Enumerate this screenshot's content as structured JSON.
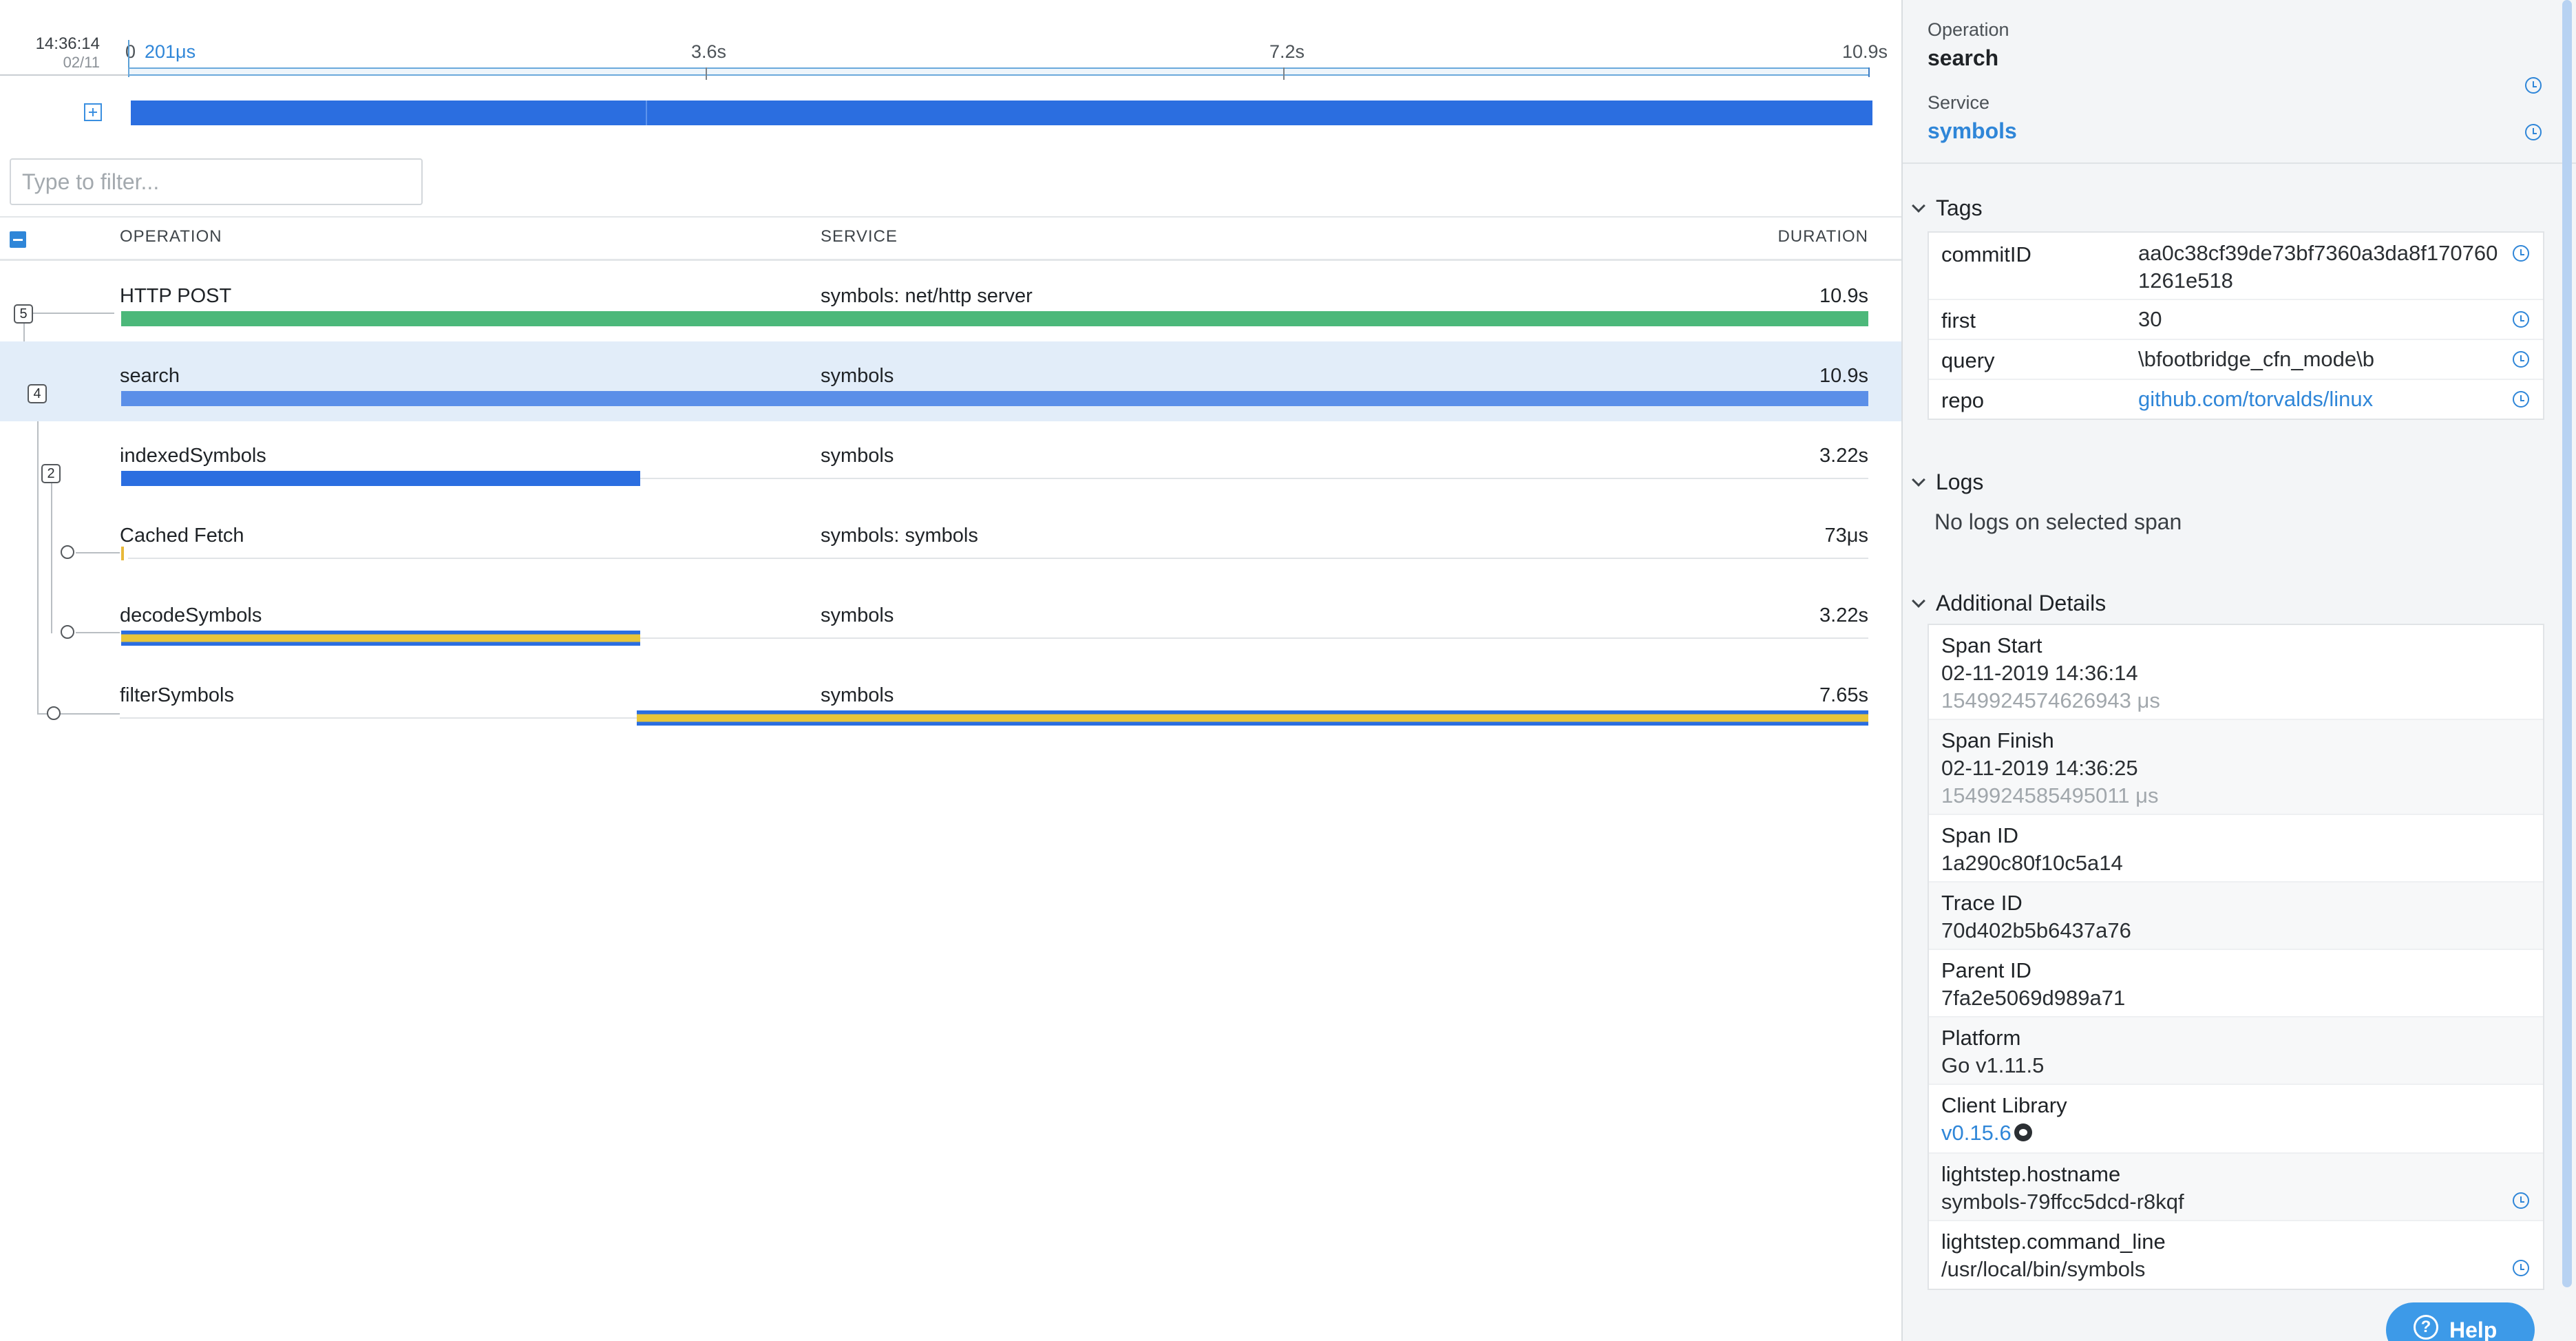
{
  "timeline": {
    "start_time": "14:36:14",
    "start_date": "02/11",
    "trunc_label": "0",
    "start_label": "201μs",
    "ticks": [
      "3.6s",
      "7.2s",
      "10.9s"
    ]
  },
  "filter": {
    "placeholder": "Type to filter...",
    "value": ""
  },
  "table": {
    "headers": {
      "operation": "OPERATION",
      "service": "SERVICE",
      "duration": "DURATION"
    },
    "rows": [
      {
        "operation": "HTTP POST",
        "service": "symbols: net/http server",
        "duration": "10.9s",
        "badge": "5",
        "bar_color": "#4cb87a",
        "bar_start": 0.0,
        "bar_end": 1.0,
        "selected": false
      },
      {
        "operation": "search",
        "service": "symbols",
        "duration": "10.9s",
        "badge": "4",
        "bar_color": "#5b8fe8",
        "bar_start": 0.0,
        "bar_end": 1.0,
        "selected": true
      },
      {
        "operation": "indexedSymbols",
        "service": "symbols",
        "duration": "3.22s",
        "badge": "2",
        "bar_color": "#2b6ee0",
        "bar_start": 0.0,
        "bar_end": 0.297,
        "selected": false
      },
      {
        "operation": "Cached Fetch",
        "service": "symbols: symbols",
        "duration": "73μs",
        "badge": "",
        "bar_color": "#e8b93a",
        "bar_start": 0.0,
        "bar_end": 0.001,
        "selected": false
      },
      {
        "operation": "decodeSymbols",
        "service": "symbols",
        "duration": "3.22s",
        "badge": "",
        "bar_color": "#e8c53a",
        "bar_start": 0.0,
        "bar_end": 0.297,
        "selected": false
      },
      {
        "operation": "filterSymbols",
        "service": "symbols",
        "duration": "7.65s",
        "badge": "",
        "bar_color": "#e8c53a",
        "bar_start": 0.295,
        "bar_end": 1.0,
        "selected": false
      }
    ]
  },
  "details": {
    "operation_label": "Operation",
    "operation_value": "search",
    "service_label": "Service",
    "service_value": "symbols",
    "tags_title": "Tags",
    "tags": [
      {
        "key": "commitID",
        "value": "aa0c38cf39de73bf7360a3da8f1707601261e518"
      },
      {
        "key": "first",
        "value": "30"
      },
      {
        "key": "query",
        "value": "\\bfootbridge_cfn_mode\\b"
      },
      {
        "key": "repo",
        "value": "github.com/torvalds/linux"
      }
    ],
    "commit_line1": "aa0c38cf39de73bf7360a3da8f170760",
    "commit_line2": "1261e518",
    "logs_title": "Logs",
    "logs_empty": "No logs on selected span",
    "additional_title": "Additional Details",
    "span_start_label": "Span Start",
    "span_start_value": "02-11-2019 14:36:14",
    "span_start_micros": "1549924574626943 μs",
    "span_finish_label": "Span Finish",
    "span_finish_value": "02-11-2019 14:36:25",
    "span_finish_micros": "1549924585495011 μs",
    "span_id_label": "Span ID",
    "span_id_value": "1a290c80f10c5a14",
    "trace_id_label": "Trace ID",
    "trace_id_value": "70d402b5b6437a76",
    "parent_id_label": "Parent ID",
    "parent_id_value": "7fa2e5069d989a71",
    "platform_label": "Platform",
    "platform_value": "Go v1.11.5",
    "client_label": "Client Library",
    "client_value": "v0.15.6",
    "hostname_label": "lightstep.hostname",
    "hostname_value": "symbols-79ffcc5dcd-r8kqf",
    "cmd_label": "lightstep.command_line",
    "cmd_value": "/usr/local/bin/symbols"
  },
  "help_label": "Help",
  "colors": {
    "accent": "#2f86d8",
    "selected_row": "#e2edf9"
  }
}
